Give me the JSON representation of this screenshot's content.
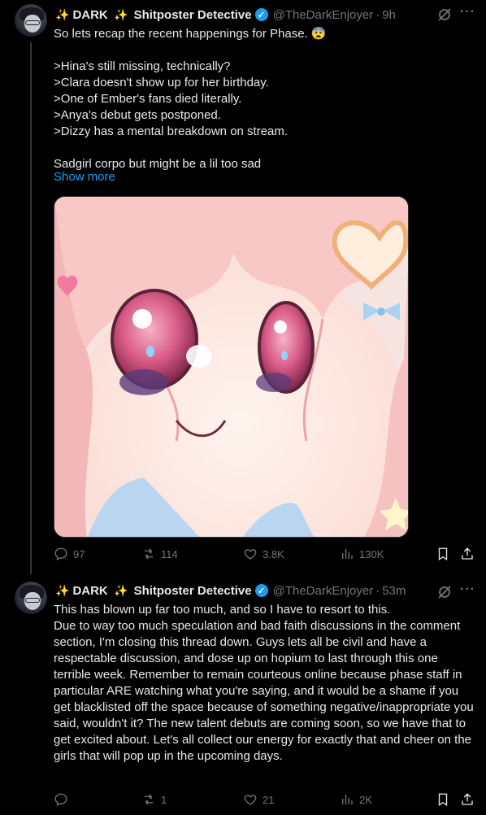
{
  "tweets": [
    {
      "author": {
        "sparkle_left": "✨",
        "display_name_part1": "DARK",
        "sparkle_mid": "✨",
        "display_name_part2": "Shitposter Detective",
        "handle": "@TheDarkEnjoyer",
        "time": "9h"
      },
      "text": "So lets recap the recent happenings for Phase. 😨\n\n>Hina's still missing, technically?\n>Clara doesn't show up for her birthday.\n>One of Ember's fans died literally.\n>Anya's debut gets postponed.\n>Dizzy has a mental breakdown on stream.\n\nSadgirl corpo but might be a lil too sad",
      "show_more": "Show more",
      "stats": {
        "replies": "97",
        "reposts": "114",
        "likes": "3.8K",
        "views": "130K"
      }
    },
    {
      "author": {
        "sparkle_left": "✨",
        "display_name_part1": "DARK",
        "sparkle_mid": "✨",
        "display_name_part2": "Shitposter Detective",
        "handle": "@TheDarkEnjoyer",
        "time": "53m"
      },
      "text": "This has blown up far too much, and so I have to resort to this.\nDue to way too much speculation and bad faith discussions in the comment section, I'm closing this thread down. Guys lets all be civil and have a respectable discussion, and dose up on hopium to last through this one terrible week. Remember to remain courteous online because phase staff in particular ARE watching what you're saying, and it would be a shame if you get blacklisted off the space because of something negative/inappropriate you said, wouldn't it? The new talent debuts are coming soon, so we have that to get excited about. Let's all collect our energy for exactly that and cheer on the girls that will pop up in the upcoming days.",
      "stats": {
        "replies": "",
        "reposts": "1",
        "likes": "21",
        "views": "2K"
      }
    }
  ],
  "ui": {
    "dot_separator": "·",
    "more_glyph": "···",
    "verified_glyph": "✓"
  },
  "colors": {
    "background": "#000000",
    "text": "#e7e9ea",
    "muted": "#71767b",
    "accent": "#1d9bf0",
    "divider": "#2f3336"
  },
  "icons": [
    "grok-icon",
    "more-icon",
    "reply-icon",
    "repost-icon",
    "like-icon",
    "views-icon",
    "bookmark-icon",
    "share-icon",
    "verified-badge-icon"
  ]
}
